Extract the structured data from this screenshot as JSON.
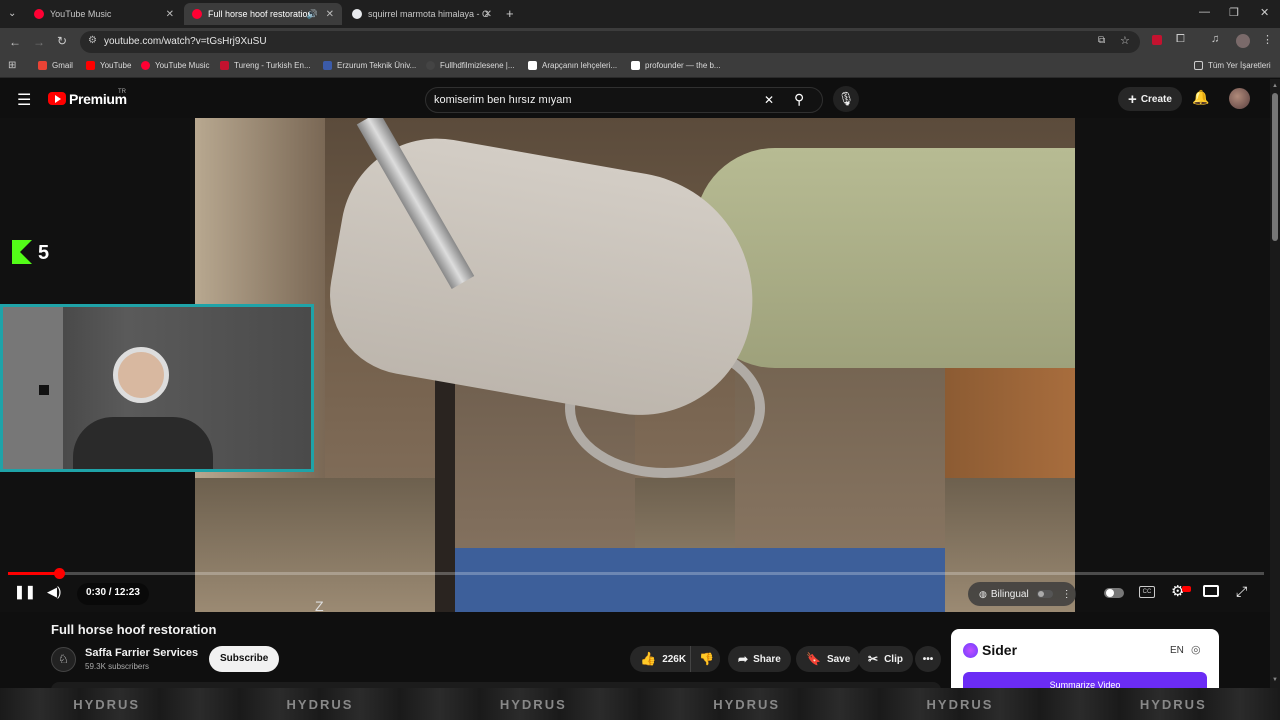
{
  "browser": {
    "tabs": [
      {
        "title": "YouTube Music",
        "favicon_color": "#ff0033"
      },
      {
        "title": "Full horse hoof restoration",
        "favicon_color": "#ff0033"
      },
      {
        "title": "squirrel marmota himalaya - G",
        "favicon_color": "#e8eaed"
      }
    ],
    "url": "youtube.com/watch?v=tGsHrj9XuSU",
    "bookmarks": [
      {
        "label": "Gmail",
        "color": "#ea4335"
      },
      {
        "label": "YouTube",
        "color": "#ff0000"
      },
      {
        "label": "YouTube Music",
        "color": "#ff0033"
      },
      {
        "label": "Tureng - Turkish En...",
        "color": "#c4122f"
      },
      {
        "label": "Erzurum Teknik Üniv...",
        "color": "#3b5ba9"
      },
      {
        "label": "Fullhdfilmizlesene |...",
        "color": "#222222"
      },
      {
        "label": "Arapçanın lehçeleri...",
        "color": "#ffffff"
      },
      {
        "label": "profounder — the b...",
        "color": "#ffffff"
      }
    ],
    "all_bookmarks": "Tüm Yer İşaretleri"
  },
  "youtube": {
    "logo_text": "Premium",
    "logo_region": "TR",
    "search_value": "komiserim ben hırsız mıyam",
    "create_label": "Create"
  },
  "player": {
    "overlay_logo": "5",
    "time": "0:30 / 12:23",
    "progress": 0.041,
    "bilingual_label": "Bilingual",
    "watermark": "Z"
  },
  "video": {
    "title": "Full horse hoof restoration",
    "channel": "Saffa Farrier Services",
    "subscribers": "59.3K subscribers",
    "subscribe_label": "Subscribe",
    "likes": "226K",
    "share_label": "Share",
    "save_label": "Save",
    "clip_label": "Clip"
  },
  "sider": {
    "name": "Sider",
    "lang": "EN",
    "summarize_label": "Summarize Video"
  },
  "taskbar": {
    "text": "HYDRUS"
  }
}
